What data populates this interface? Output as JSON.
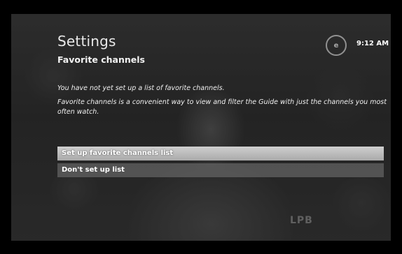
{
  "header": {
    "title": "Settings",
    "subtitle": "Favorite channels",
    "clock": "9:12 AM",
    "logo_text": "e"
  },
  "messages": [
    "You have not yet set up a list of favorite channels.",
    "Favorite channels is a convenient way to view and filter the Guide with just the channels you most often watch."
  ],
  "menu": {
    "items": [
      {
        "label": "Set up favorite channels list",
        "selected": true
      },
      {
        "label": "Don't set up list",
        "selected": false
      }
    ]
  },
  "watermark": "LPB",
  "colors": {
    "background": "#000000",
    "highlight": "#c0c0c0",
    "text": "#ffffff"
  }
}
